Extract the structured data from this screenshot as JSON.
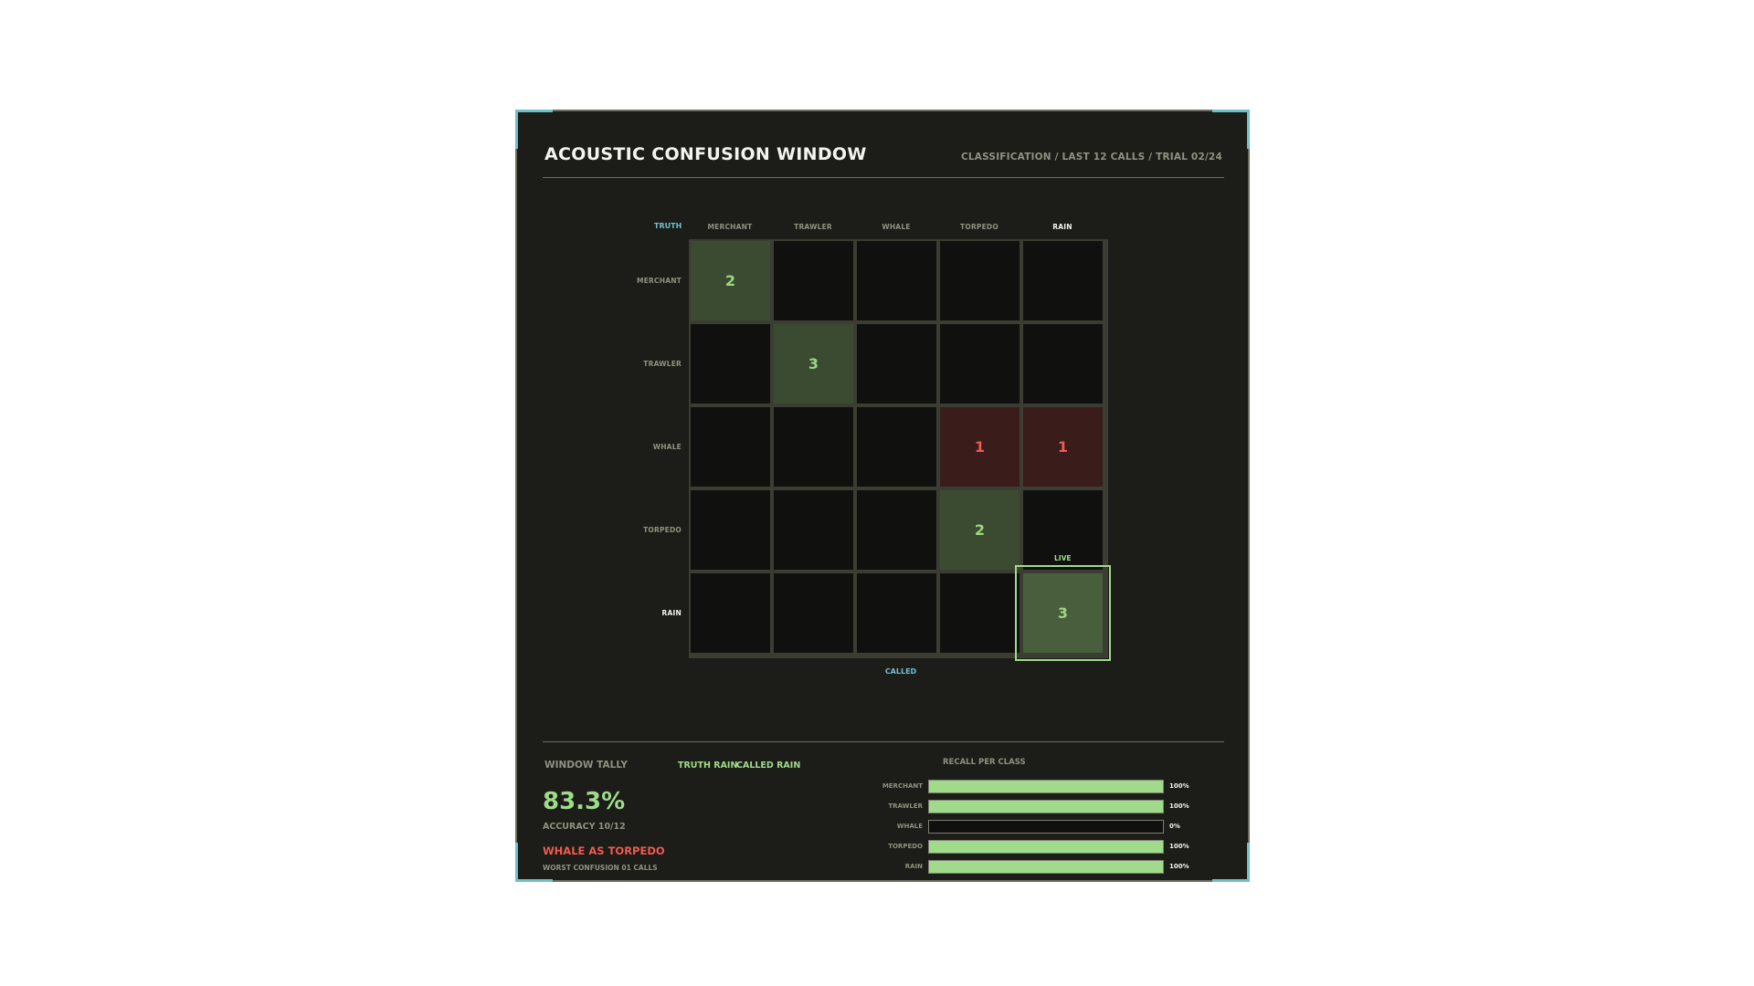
{
  "header": {
    "title": "ACOUSTIC CONFUSION WINDOW",
    "subtitle": "CLASSIFICATION / LAST 12 CALLS / TRIAL 02/24"
  },
  "matrix": {
    "axis_truth": "TRUTH",
    "axis_called": "CALLED",
    "classes": [
      "MERCHANT",
      "TRAWLER",
      "WHALE",
      "TORPEDO",
      "RAIN"
    ],
    "live_label": "LIVE",
    "live_cell": [
      4,
      4
    ],
    "counts": [
      [
        2,
        0,
        0,
        0,
        0
      ],
      [
        0,
        3,
        0,
        0,
        0
      ],
      [
        0,
        0,
        0,
        1,
        1
      ],
      [
        0,
        0,
        0,
        2,
        0
      ],
      [
        0,
        0,
        0,
        0,
        3
      ]
    ],
    "colors": {
      "hit": "#3b4b31",
      "miss": "#3a1c1a",
      "live": "#9fdb8a"
    }
  },
  "tally": {
    "label": "WINDOW TALLY",
    "truth_text": "TRUTH RAIN",
    "called_text": "CALLED RAIN",
    "accuracy": "83.3%",
    "accuracy_detail": "ACCURACY 10/12",
    "worst_confusion": "WHALE AS TORPEDO",
    "worst_detail": "WORST CONFUSION 01 CALLS"
  },
  "recall": {
    "title": "RECALL PER CLASS",
    "rows": [
      {
        "name": "MERCHANT",
        "value": 1.0,
        "pct": "100%"
      },
      {
        "name": "TRAWLER",
        "value": 1.0,
        "pct": "100%"
      },
      {
        "name": "WHALE",
        "value": 0.0,
        "pct": "0%"
      },
      {
        "name": "TORPEDO",
        "value": 1.0,
        "pct": "100%"
      },
      {
        "name": "RAIN",
        "value": 1.0,
        "pct": "100%"
      }
    ]
  }
}
